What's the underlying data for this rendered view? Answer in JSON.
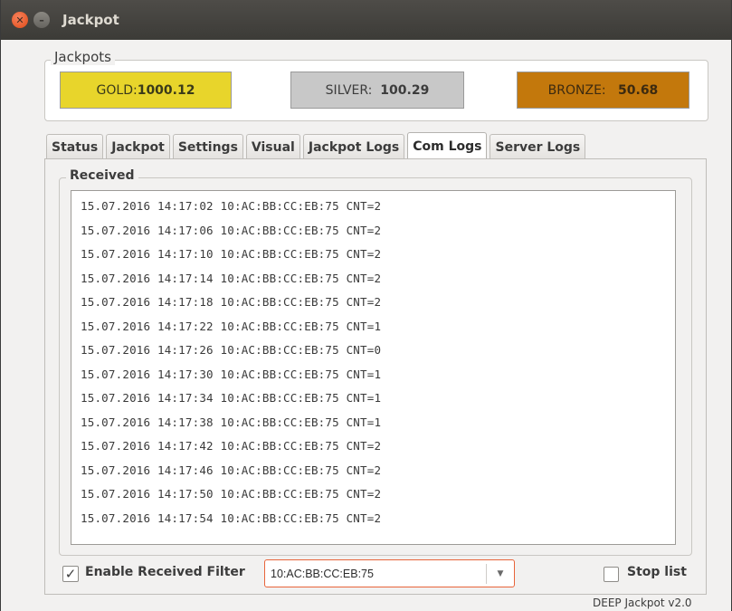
{
  "window": {
    "title": "Jackpot"
  },
  "jackpots": {
    "legend": "Jackpots",
    "gold": {
      "label": "GOLD:",
      "value": "1000.12",
      "color": "#e8d52b"
    },
    "silver": {
      "label": "SILVER:",
      "value": "100.29",
      "color": "#c8c8c8"
    },
    "bronze": {
      "label": "BRONZE:",
      "value": "50.68",
      "color": "#c3780c"
    }
  },
  "tabs": [
    {
      "label": "Status",
      "active": false
    },
    {
      "label": "Jackpot",
      "active": false
    },
    {
      "label": "Settings",
      "active": false
    },
    {
      "label": "Visual",
      "active": false
    },
    {
      "label": "Jackpot Logs",
      "active": false
    },
    {
      "label": "Com Logs",
      "active": true
    },
    {
      "label": "Server Logs",
      "active": false
    }
  ],
  "received": {
    "legend": "Received",
    "lines": [
      "15.07.2016 14:17:02 10:AC:BB:CC:EB:75 CNT=2",
      "15.07.2016 14:17:06 10:AC:BB:CC:EB:75 CNT=2",
      "15.07.2016 14:17:10 10:AC:BB:CC:EB:75 CNT=2",
      "15.07.2016 14:17:14 10:AC:BB:CC:EB:75 CNT=2",
      "15.07.2016 14:17:18 10:AC:BB:CC:EB:75 CNT=2",
      "15.07.2016 14:17:22 10:AC:BB:CC:EB:75 CNT=1",
      "15.07.2016 14:17:26 10:AC:BB:CC:EB:75 CNT=0",
      "15.07.2016 14:17:30 10:AC:BB:CC:EB:75 CNT=1",
      "15.07.2016 14:17:34 10:AC:BB:CC:EB:75 CNT=1",
      "15.07.2016 14:17:38 10:AC:BB:CC:EB:75 CNT=1",
      "15.07.2016 14:17:42 10:AC:BB:CC:EB:75 CNT=2",
      "15.07.2016 14:17:46 10:AC:BB:CC:EB:75 CNT=2",
      "15.07.2016 14:17:50 10:AC:BB:CC:EB:75 CNT=2",
      "15.07.2016 14:17:54 10:AC:BB:CC:EB:75 CNT=2"
    ]
  },
  "filter": {
    "checkbox_label": "Enable Received Filter",
    "checked": true,
    "value": "10:AC:BB:CC:EB:75"
  },
  "stop_list": {
    "label": "Stop list",
    "checked": false
  },
  "footer": {
    "version": "DEEP Jackpot v2.0"
  },
  "icons": {
    "close": "close-icon",
    "minimize": "minimize-icon",
    "dropdown": "chevron-down-icon",
    "check": "checkmark-icon"
  },
  "colors": {
    "focus_border": "#e8643a",
    "titlebar": "#3c3b37"
  }
}
